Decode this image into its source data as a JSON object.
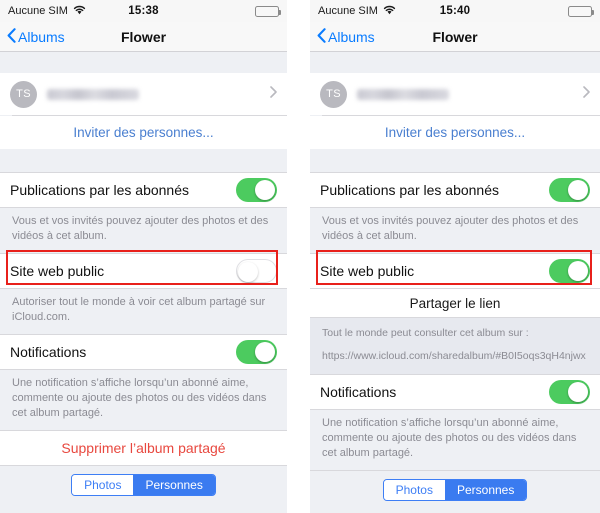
{
  "panels": [
    {
      "id": "before",
      "statusbar": {
        "carrier": "Aucune SIM",
        "time": "15:38",
        "wifi_icon": "wifi-icon",
        "battery_icon": "battery-icon"
      },
      "navbar": {
        "back_label": "Albums",
        "back_icon": "chevron-left-icon",
        "title": "Flower"
      },
      "person": {
        "avatar_initials": "TS",
        "name_redacted": "",
        "disclosure_icon": "chevron-right-icon"
      },
      "invite_label": "Inviter des personnes...",
      "subscriber_posts": {
        "label": "Publications par les abonnés",
        "state": "on"
      },
      "subscriber_posts_desc": "Vous et vos invités pouvez ajouter des photos et des vidéos à cet album.",
      "public_website": {
        "label": "Site web public",
        "state": "off"
      },
      "public_website_desc": "Autoriser tout le monde à voir cet album partagé sur iCloud.com.",
      "notifications": {
        "label": "Notifications",
        "state": "on"
      },
      "notifications_desc": "Une notification s’affiche lorsqu’un abonné aime, commente ou ajoute des photos ou des vidéos dans cet album partagé.",
      "delete_label": "Supprimer l’album partagé",
      "tabs": [
        {
          "label": "Photos",
          "selected": false
        },
        {
          "label": "Personnes",
          "selected": true
        }
      ]
    },
    {
      "id": "after",
      "statusbar": {
        "carrier": "Aucune SIM",
        "time": "15:40",
        "wifi_icon": "wifi-icon",
        "battery_icon": "battery-icon"
      },
      "navbar": {
        "back_label": "Albums",
        "back_icon": "chevron-left-icon",
        "title": "Flower"
      },
      "person": {
        "avatar_initials": "TS",
        "name_redacted": "",
        "disclosure_icon": "chevron-right-icon"
      },
      "invite_label": "Inviter des personnes...",
      "subscriber_posts": {
        "label": "Publications par les abonnés",
        "state": "on"
      },
      "subscriber_posts_desc": "Vous et vos invités pouvez ajouter des photos et des vidéos à cet album.",
      "public_website": {
        "label": "Site web public",
        "state": "on"
      },
      "share_link_label": "Partager le lien",
      "share_link_intro": "Tout le monde peut consulter cet album sur :",
      "share_link_url": "https://www.icloud.com/sharedalbum/#B0I5oqs3qH4njwx",
      "notifications": {
        "label": "Notifications",
        "state": "on"
      },
      "notifications_desc": "Une notification s’affiche lorsqu’un abonné aime, commente ou ajoute des photos ou des vidéos dans cet album partagé.",
      "tabs": [
        {
          "label": "Photos",
          "selected": false
        },
        {
          "label": "Personnes",
          "selected": true
        }
      ]
    }
  ],
  "colors": {
    "accent_blue": "#3a7bf0",
    "link_blue": "#4a7fd0",
    "switch_on_green": "#4ccb5f",
    "destructive_red": "#e8483f",
    "highlight_red": "#e8201b",
    "group_background": "#eef0f4"
  }
}
